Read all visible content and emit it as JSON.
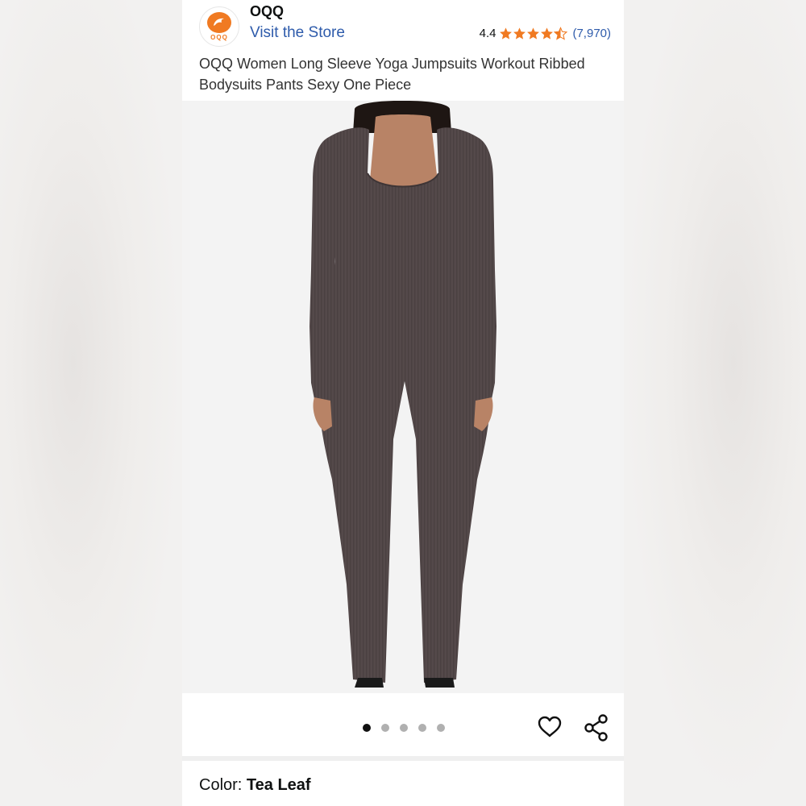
{
  "store": {
    "name": "OQQ",
    "logo_text": "OQQ",
    "visit_label": "Visit the Store",
    "logo_icon": "dolphin-logo-icon"
  },
  "rating": {
    "value": "4.4",
    "stars": 4.5,
    "count": "(7,970)",
    "star_color": "#f07a22"
  },
  "product": {
    "title": "OQQ Women Long Sleeve Yoga Jumpsuits Workout Ribbed Bodysuits Pants Sexy One Piece",
    "garment_color": "#54494a"
  },
  "gallery": {
    "total_images": 5,
    "active_index": 0
  },
  "actions": {
    "wishlist_icon": "heart-icon",
    "share_icon": "share-icon"
  },
  "color_selector": {
    "label": "Color: ",
    "value": "Tea Leaf"
  },
  "colors": {
    "link": "#2e5bab",
    "accent": "#f07a22"
  }
}
